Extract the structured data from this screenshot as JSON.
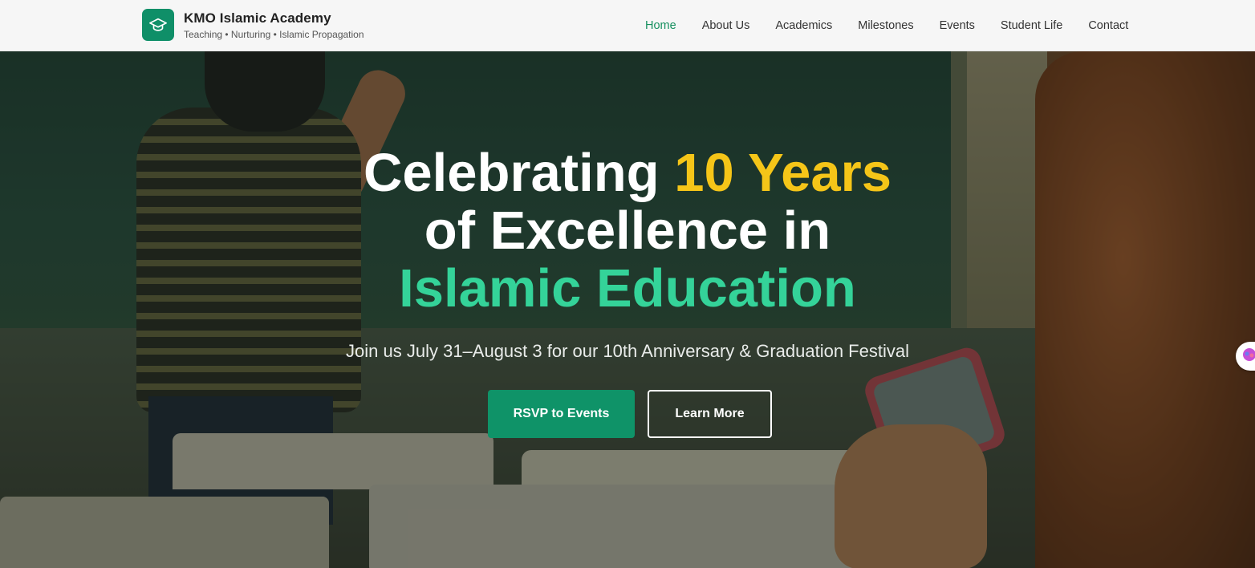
{
  "brand": {
    "name": "KMO Islamic Academy",
    "tagline": "Teaching • Nurturing • Islamic Propagation",
    "logo_icon": "graduation-cap-icon"
  },
  "nav": {
    "items": [
      {
        "label": "Home",
        "active": true
      },
      {
        "label": "About Us",
        "active": false
      },
      {
        "label": "Academics",
        "active": false
      },
      {
        "label": "Milestones",
        "active": false
      },
      {
        "label": "Events",
        "active": false
      },
      {
        "label": "Student Life",
        "active": false
      },
      {
        "label": "Contact",
        "active": false
      }
    ]
  },
  "hero": {
    "headline_part1": "Celebrating ",
    "headline_highlight1": "10 Years",
    "headline_part2": "of Excellence in",
    "headline_highlight2": "Islamic Education",
    "subtitle": "Join us July 31–August 3 for our 10th Anniversary & Graduation Festival",
    "primary_button": "RSVP to Events",
    "secondary_button": "Learn More"
  },
  "colors": {
    "brand_green": "#0f9368",
    "highlight_yellow": "#f5c518",
    "highlight_green": "#34d399",
    "nav_active": "#16905f"
  },
  "side_widget": {
    "icon": "assistant-bubble-icon"
  }
}
